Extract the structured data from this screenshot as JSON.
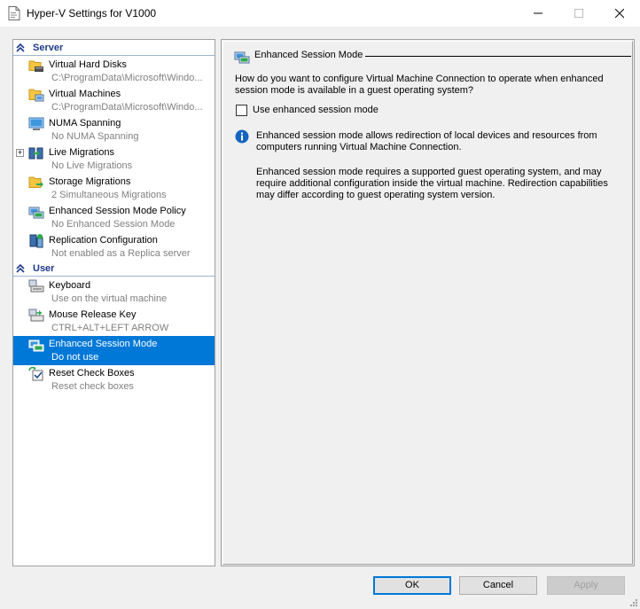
{
  "window": {
    "title": "Hyper-V Settings for V1000"
  },
  "sidebar": {
    "sections": [
      {
        "label": "Server"
      },
      {
        "label": "User"
      }
    ],
    "server_items": [
      {
        "label": "Virtual Hard Disks",
        "sub": "C:\\ProgramData\\Microsoft\\Windo...",
        "icon": "folder-disk-icon"
      },
      {
        "label": "Virtual Machines",
        "sub": "C:\\ProgramData\\Microsoft\\Windo...",
        "icon": "folder-vm-icon"
      },
      {
        "label": "NUMA Spanning",
        "sub": "No NUMA Spanning",
        "icon": "numa-icon"
      },
      {
        "label": "Live Migrations",
        "sub": "No Live Migrations",
        "icon": "live-migration-icon",
        "expander": "+"
      },
      {
        "label": "Storage Migrations",
        "sub": "2 Simultaneous Migrations",
        "icon": "storage-migration-icon"
      },
      {
        "label": "Enhanced Session Mode Policy",
        "sub": "No Enhanced Session Mode",
        "icon": "session-policy-icon"
      },
      {
        "label": "Replication Configuration",
        "sub": "Not enabled as a Replica server",
        "icon": "replication-icon"
      }
    ],
    "user_items": [
      {
        "label": "Keyboard",
        "sub": "Use on the virtual machine",
        "icon": "keyboard-icon"
      },
      {
        "label": "Mouse Release Key",
        "sub": "CTRL+ALT+LEFT ARROW",
        "icon": "mouse-icon"
      },
      {
        "label": "Enhanced Session Mode",
        "sub": "Do not use",
        "icon": "session-mode-icon",
        "selected": true
      },
      {
        "label": "Reset Check Boxes",
        "sub": "Reset check boxes",
        "icon": "reset-checkbox-icon"
      }
    ]
  },
  "panel": {
    "group_title": "Enhanced Session Mode",
    "question": "How do you want to configure Virtual Machine Connection to operate when enhanced session mode is available in a guest operating system?",
    "checkbox_label": "Use enhanced session mode",
    "checkbox_checked": false,
    "info1": "Enhanced session mode allows redirection of local devices and resources from computers running Virtual Machine Connection.",
    "info2": "Enhanced session mode requires a supported guest operating system, and may require additional configuration inside the virtual machine. Redirection capabilities may differ according to guest operating system version."
  },
  "buttons": {
    "ok": "OK",
    "cancel": "Cancel",
    "apply": "Apply"
  },
  "colors": {
    "selection": "#0078d7",
    "section_header": "#1e3a8a",
    "info_icon": "#1565c0"
  }
}
